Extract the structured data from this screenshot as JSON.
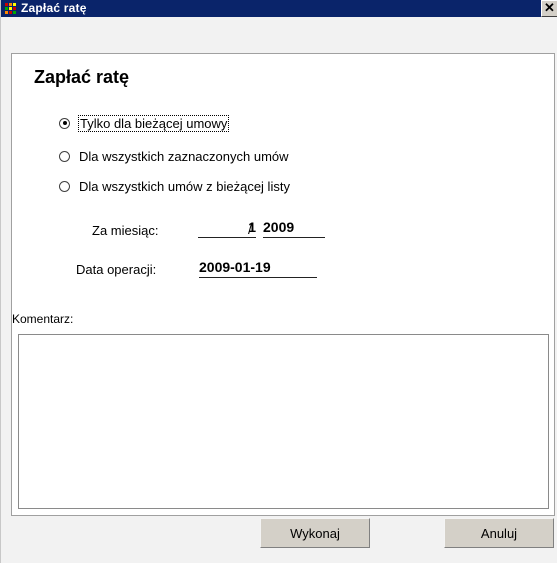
{
  "window": {
    "title": "Zapłać ratę",
    "close_glyph": "✕"
  },
  "form": {
    "heading": "Zapłać ratę",
    "options": [
      {
        "label": "Tylko dla bieżącej umowy",
        "checked": true
      },
      {
        "label": "Dla wszystkich zaznaczonych umów",
        "checked": false
      },
      {
        "label": "Dla wszystkich umów z bieżącej listy",
        "checked": false
      }
    ],
    "month_label": "Za miesiąc:",
    "month_value": "1",
    "month_separator": "/",
    "year_value": "2009",
    "date_label": "Data operacji:",
    "date_value": "2009-01-19",
    "comment_label": "Komentarz:",
    "comment_value": ""
  },
  "buttons": {
    "ok": "Wykonaj",
    "cancel": "Anuluj"
  },
  "colors": {
    "titlebar": "#0a246a",
    "button_face": "#d4d0c8",
    "window_bg": "#f2f2f2"
  }
}
